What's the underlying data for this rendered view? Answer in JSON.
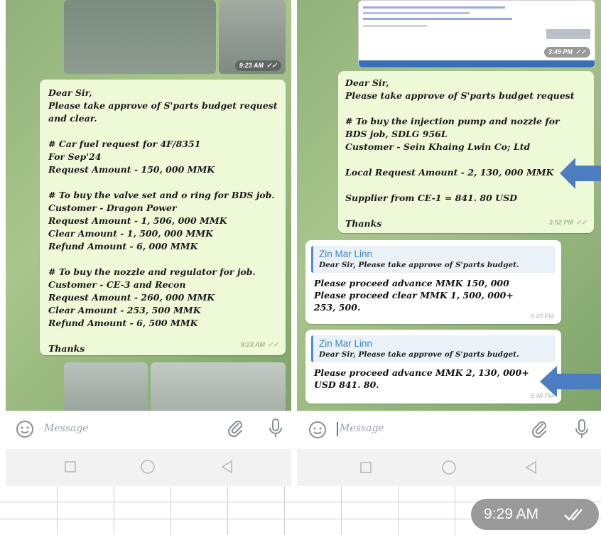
{
  "left": {
    "top_photo_time": "9:23 AM",
    "message": {
      "lines": [
        "Dear Sir,",
        "Please take approve of S'parts budget request",
        "and clear.",
        "",
        "# Car fuel request for 4F/8351",
        "For Sep'24",
        "Request Amount - 150, 000 MMK",
        "",
        "# To buy the valve set and o ring for BDS job.",
        "Customer - Dragon Power",
        "Request Amount - 1, 506, 000 MMK",
        "Clear Amount - 1, 500, 000 MMK",
        "Refund Amount - 6, 000 MMK",
        "",
        "# To buy the nozzle and regulator for job.",
        "Customer - CE-3 and Recon",
        "Request Amount - 260, 000 MMK",
        "Clear Amount - 253, 500 MMK",
        "Refund Amount - 6, 500 MMK",
        "",
        "Thanks"
      ],
      "time": "9:23 AM"
    },
    "input_placeholder": "Message"
  },
  "right": {
    "email_photo_time": "3:49 PM",
    "message": {
      "lines": [
        "Dear Sir,",
        "Please take approve of S'parts budget request",
        "",
        "# To buy the injection pump and nozzle for",
        "BDS job, SDLG 956L",
        "Customer - Sein Khaing Lwin Co; Ltd",
        "",
        "Local Request Amount - 2, 130, 000 MMK",
        "",
        "Supplier from CE-1 = 841. 80 USD",
        "",
        "Thanks"
      ],
      "time": "3:52 PM"
    },
    "replies": [
      {
        "sender": "Zin Mar Linn",
        "quote": "Dear Sir,  Please take approve of S'parts budget.",
        "lines": [
          "Please proceed advance MMK 150, 000",
          "Please proceed clear MMK 1, 500, 000+",
          "253, 500."
        ],
        "time": "8:45 PM"
      },
      {
        "sender": "Zin Mar Linn",
        "quote": "Dear Sir,  Please take approve of S'parts budget.",
        "lines": [
          "Please proceed advance MMK 2, 130, 000+",
          "USD 841. 80."
        ],
        "time": "8:48 PM"
      }
    ],
    "input_placeholder": "Message"
  },
  "icons": {
    "emoji": "emoji-icon",
    "attach": "paperclip-icon",
    "mic": "microphone-icon",
    "read": "double-check-icon"
  },
  "overlay": {
    "time": "9:29 AM"
  },
  "colors": {
    "accent": "#3d85c6",
    "arrow": "#4b7dc0",
    "bubble": "#eef9d8"
  }
}
